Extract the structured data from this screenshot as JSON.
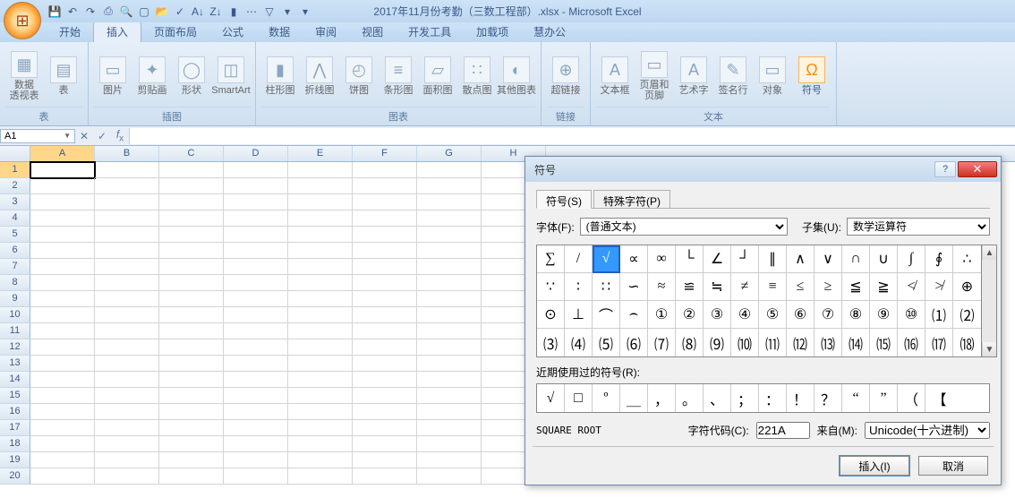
{
  "title": "2017年11月份考勤（三数工程部）.xlsx - Microsoft Excel",
  "qat_icons": [
    "save-icon",
    "undo-icon",
    "redo-icon",
    "print-icon",
    "preview-icon",
    "new-icon",
    "open-icon",
    "spell-icon",
    "sort-asc-icon",
    "sort-desc-icon",
    "chart-icon",
    "more-icon",
    "filter-icon",
    "funnel-icon",
    "dropdown-icon"
  ],
  "tabs": [
    "开始",
    "插入",
    "页面布局",
    "公式",
    "数据",
    "审阅",
    "视图",
    "开发工具",
    "加载项",
    "慧办公"
  ],
  "active_tab_index": 1,
  "ribbon": {
    "groups": [
      {
        "label": "表",
        "buttons": [
          {
            "name": "pivot",
            "label": "数据\n透视表",
            "ico": "▦"
          },
          {
            "name": "table",
            "label": "表",
            "ico": "▤"
          }
        ]
      },
      {
        "label": "插图",
        "buttons": [
          {
            "name": "picture",
            "label": "图片",
            "ico": "▭"
          },
          {
            "name": "clipart",
            "label": "剪贴画",
            "ico": "✦"
          },
          {
            "name": "shapes",
            "label": "形状",
            "ico": "◯"
          },
          {
            "name": "smartart",
            "label": "SmartArt",
            "ico": "◫"
          }
        ]
      },
      {
        "label": "图表",
        "buttons": [
          {
            "name": "column",
            "label": "柱形图",
            "ico": "▮"
          },
          {
            "name": "line",
            "label": "折线图",
            "ico": "⋀"
          },
          {
            "name": "pie",
            "label": "饼图",
            "ico": "◴"
          },
          {
            "name": "bar",
            "label": "条形图",
            "ico": "≡"
          },
          {
            "name": "area",
            "label": "面积图",
            "ico": "▱"
          },
          {
            "name": "scatter",
            "label": "散点图",
            "ico": "∷"
          },
          {
            "name": "other",
            "label": "其他图表",
            "ico": "◐"
          }
        ]
      },
      {
        "label": "链接",
        "buttons": [
          {
            "name": "hyperlink",
            "label": "超链接",
            "ico": "⊕"
          }
        ]
      },
      {
        "label": "文本",
        "buttons": [
          {
            "name": "textbox",
            "label": "文本框",
            "ico": "A"
          },
          {
            "name": "header",
            "label": "页眉和\n页脚",
            "ico": "▭"
          },
          {
            "name": "wordart",
            "label": "艺术字",
            "ico": "A"
          },
          {
            "name": "sigline",
            "label": "签名行",
            "ico": "✎"
          },
          {
            "name": "object",
            "label": "对象",
            "ico": "▭"
          },
          {
            "name": "symbol",
            "label": "符号",
            "ico": "Ω",
            "hl": true
          }
        ]
      }
    ]
  },
  "namebox": "A1",
  "columns": [
    "A",
    "B",
    "C",
    "D",
    "E",
    "F",
    "G",
    "H"
  ],
  "row_count": 20,
  "active_cell": "A1",
  "dialog": {
    "title": "符号",
    "tabs": [
      "符号(S)",
      "特殊字符(P)"
    ],
    "font_label": "字体(F):",
    "font_value": "(普通文本)",
    "subset_label": "子集(U):",
    "subset_value": "数学运算符",
    "symbols": [
      [
        "∑",
        "/",
        "√",
        "∝",
        "∞",
        "└",
        "∠",
        "┘",
        "∥",
        "∧",
        "∨",
        "∩",
        "∪",
        "∫",
        "∮",
        "∴"
      ],
      [
        "∵",
        "∶",
        "∷",
        "∽",
        "≈",
        "≌",
        "≒",
        "≠",
        "≡",
        "≤",
        "≥",
        "≦",
        "≧",
        "≮",
        "≯",
        "⊕"
      ],
      [
        "⊙",
        "⊥",
        "⌒",
        "⌢",
        "①",
        "②",
        "③",
        "④",
        "⑤",
        "⑥",
        "⑦",
        "⑧",
        "⑨",
        "⑩",
        "⑴",
        "⑵"
      ],
      [
        "⑶",
        "⑷",
        "⑸",
        "⑹",
        "⑺",
        "⑻",
        "⑼",
        "⑽",
        "⑾",
        "⑿",
        "⒀",
        "⒁",
        "⒂",
        "⒃",
        "⒄",
        "⒅"
      ]
    ],
    "selected_symbol": "√",
    "recent_label": "近期使用过的符号(R):",
    "recent": [
      "√",
      "□",
      "º",
      "＿",
      "，",
      "。",
      "、",
      "；",
      "：",
      "！",
      "？",
      "“",
      "”",
      "（",
      "【"
    ],
    "char_name": "SQUARE ROOT",
    "code_label": "字符代码(C):",
    "code_value": "221A",
    "from_label": "来自(M):",
    "from_value": "Unicode(十六进制)",
    "insert": "插入(I)",
    "cancel": "取消"
  }
}
